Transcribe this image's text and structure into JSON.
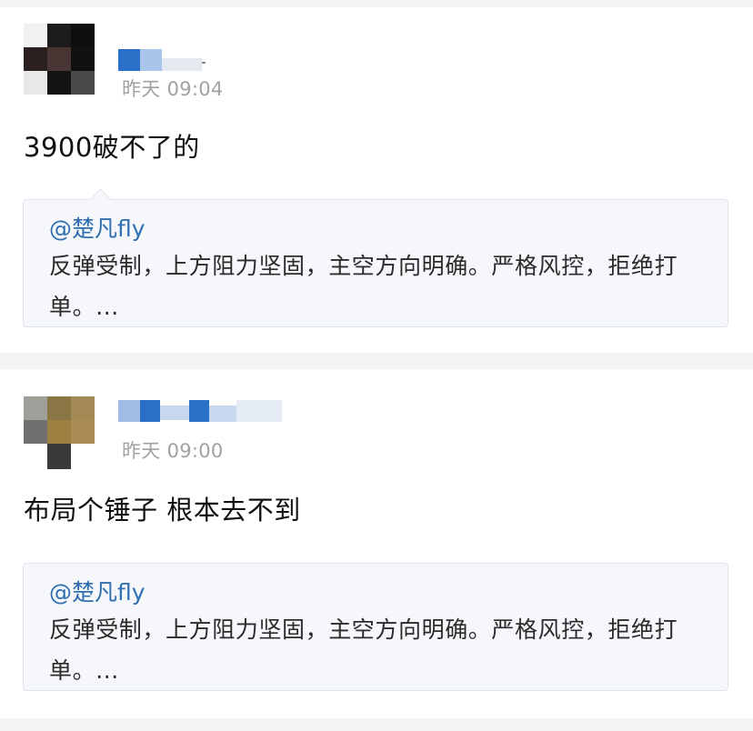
{
  "posts": [
    {
      "time": "昨天 09:04",
      "content": "3900破不了的",
      "quote": {
        "author": "@楚凡fly",
        "text": "反弹受制，上方阻力坚固，主空方向明确。严格风控，拒绝打单。..."
      }
    },
    {
      "time": "昨天 09:00",
      "content": "布局个锤子 根本去不到",
      "quote": {
        "author": "@楚凡fly",
        "text": "反弹受制，上方阻力坚固，主空方向明确。严格风控，拒绝打单。..."
      }
    }
  ],
  "colors": {
    "link": "#2e6fb2",
    "timestamp": "#a1a1a6",
    "separator": "#f2f3f5",
    "quote_bg": "#f5f7fa"
  }
}
